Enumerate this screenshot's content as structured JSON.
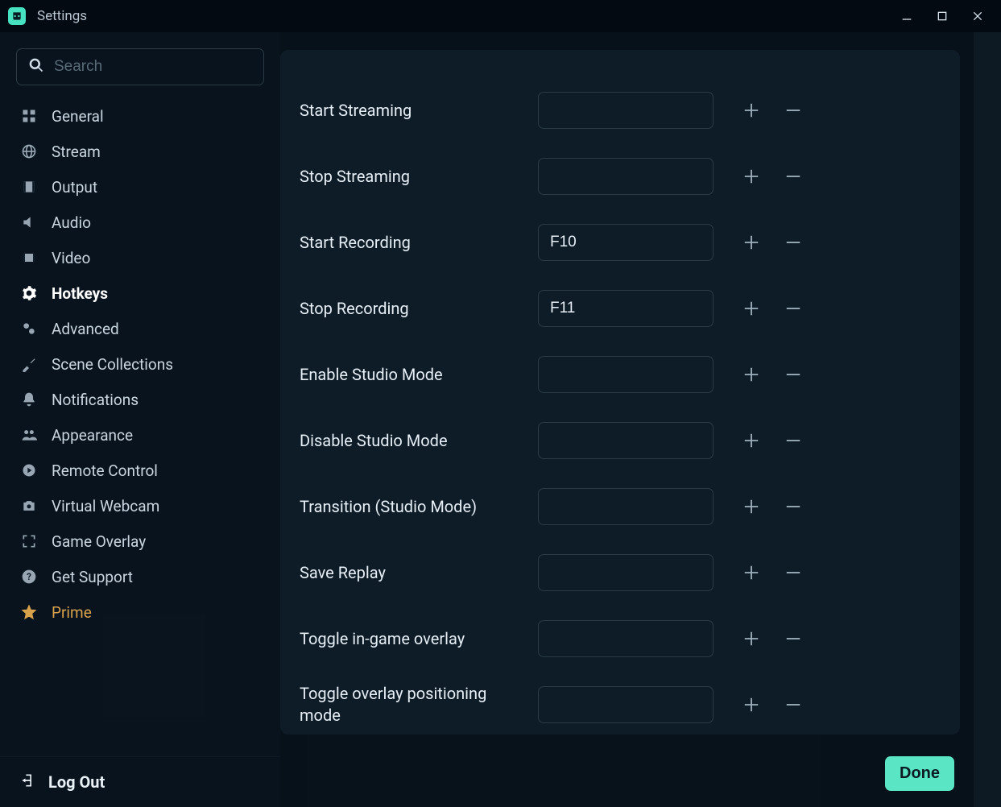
{
  "titlebar": {
    "title": "Settings"
  },
  "search": {
    "placeholder": "Search"
  },
  "sidebar": {
    "items": [
      {
        "label": "General",
        "icon": "grid"
      },
      {
        "label": "Stream",
        "icon": "globe"
      },
      {
        "label": "Output",
        "icon": "film"
      },
      {
        "label": "Audio",
        "icon": "volume"
      },
      {
        "label": "Video",
        "icon": "video"
      },
      {
        "label": "Hotkeys",
        "icon": "gear",
        "active": true
      },
      {
        "label": "Advanced",
        "icon": "gears"
      },
      {
        "label": "Scene Collections",
        "icon": "tools"
      },
      {
        "label": "Notifications",
        "icon": "bell"
      },
      {
        "label": "Appearance",
        "icon": "people"
      },
      {
        "label": "Remote Control",
        "icon": "play-circle"
      },
      {
        "label": "Virtual Webcam",
        "icon": "camera"
      },
      {
        "label": "Game Overlay",
        "icon": "expand"
      },
      {
        "label": "Get Support",
        "icon": "question"
      },
      {
        "label": "Prime",
        "icon": "star",
        "prime": true
      }
    ]
  },
  "logout": {
    "label": "Log Out"
  },
  "hotkeys": {
    "rows": [
      {
        "label": "Start Streaming",
        "value": ""
      },
      {
        "label": "Stop Streaming",
        "value": ""
      },
      {
        "label": "Start Recording",
        "value": "F10"
      },
      {
        "label": "Stop Recording",
        "value": "F11"
      },
      {
        "label": "Enable Studio Mode",
        "value": ""
      },
      {
        "label": "Disable Studio Mode",
        "value": ""
      },
      {
        "label": "Transition (Studio Mode)",
        "value": ""
      },
      {
        "label": "Save Replay",
        "value": ""
      },
      {
        "label": "Toggle in-game overlay",
        "value": ""
      },
      {
        "label": "Toggle overlay positioning mode",
        "value": ""
      }
    ]
  },
  "footer": {
    "done_label": "Done"
  }
}
